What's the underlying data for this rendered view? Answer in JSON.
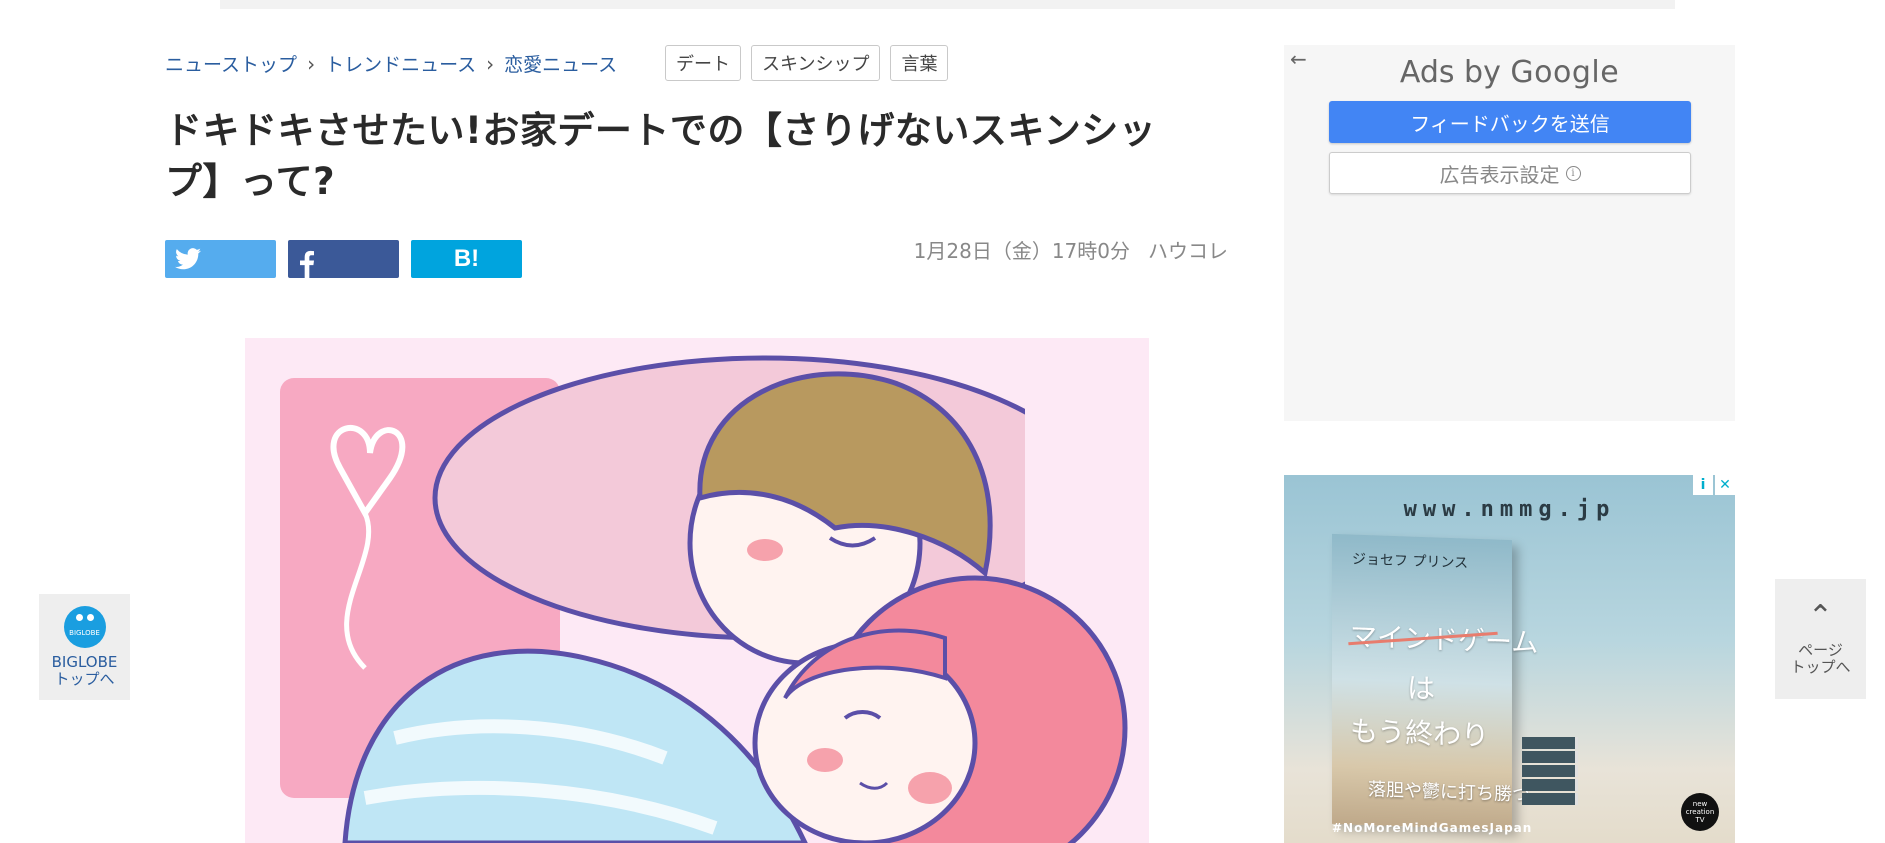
{
  "breadcrumb": [
    {
      "label": "ニューストップ"
    },
    {
      "label": "トレンドニュース"
    },
    {
      "label": "恋愛ニュース"
    }
  ],
  "tags": [
    "デート",
    "スキンシップ",
    "言葉"
  ],
  "article": {
    "title": "ドキドキさせたい!お家デートでの【さりげないスキンシップ】って?",
    "date": "1月28日（金）17時0分",
    "source": "ハウコレ"
  },
  "share": {
    "hatena_label": "B!"
  },
  "ad_google": {
    "header_plain": "Ads by ",
    "header_brand": "Google",
    "feedback_button": "フィードバックを送信",
    "settings_button": "広告表示設定"
  },
  "ad_banner": {
    "url": "www.nmmg.jp",
    "book_author": "ジョセフ プリンス",
    "book_title_1": "マインドゲーム",
    "book_title_2": "は",
    "book_title_3": "もう終わり",
    "book_subtitle": "落胆や鬱に打ち勝つ",
    "hashtag": "#NoMoreMindGamesJapan",
    "logo_text": "new creation TV"
  },
  "side": {
    "left_logo": "BIGLOBE",
    "left_label_1": "BIGLOBE",
    "left_label_2": "トップへ",
    "right_label_1": "ページ",
    "right_label_2": "トップへ"
  },
  "colors": {
    "link": "#2a5d9f",
    "twitter": "#55acee",
    "facebook": "#3b5998",
    "hatena": "#00a4de",
    "google_blue": "#4285f4"
  },
  "icons": [
    "twitter-icon",
    "facebook-icon",
    "back-arrow-icon",
    "info-icon",
    "chevron-up-icon",
    "ad-close-icon"
  ]
}
